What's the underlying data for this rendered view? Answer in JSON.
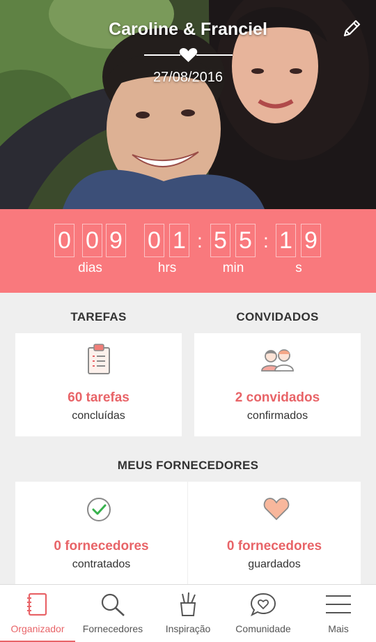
{
  "hero": {
    "couple_names": "Caroline & Franciel",
    "wedding_date": "27/08/2016"
  },
  "countdown": {
    "days_digits": [
      "0",
      "0",
      "9"
    ],
    "hours_digits": [
      "0",
      "1"
    ],
    "minutes_digits": [
      "5",
      "5"
    ],
    "seconds_digits": [
      "1",
      "9"
    ],
    "separator": ":",
    "days_label": "dias",
    "hours_label": "hrs",
    "minutes_label": "min",
    "seconds_label": "s"
  },
  "tasks": {
    "header": "TAREFAS",
    "count_text": "60 tarefas",
    "status_text": "concluídas"
  },
  "guests": {
    "header": "CONVIDADOS",
    "count_text": "2 convidados",
    "status_text": "confirmados"
  },
  "suppliers": {
    "header": "MEUS FORNECEDORES",
    "hired_count_text": "0 fornecedores",
    "hired_status_text": "contratados",
    "saved_count_text": "0 fornecedores",
    "saved_status_text": "guardados"
  },
  "bottom_nav": {
    "items": [
      {
        "label": "Organizador",
        "icon": "notebook-icon",
        "active": true
      },
      {
        "label": "Fornecedores",
        "icon": "search-icon",
        "active": false
      },
      {
        "label": "Inspiração",
        "icon": "pencil-cup-icon",
        "active": false
      },
      {
        "label": "Comunidade",
        "icon": "chat-heart-icon",
        "active": false
      },
      {
        "label": "Mais",
        "icon": "menu-icon",
        "active": false
      }
    ]
  },
  "colors": {
    "accent": "#f9797d",
    "accent_text": "#e86468",
    "background": "#efefef"
  }
}
